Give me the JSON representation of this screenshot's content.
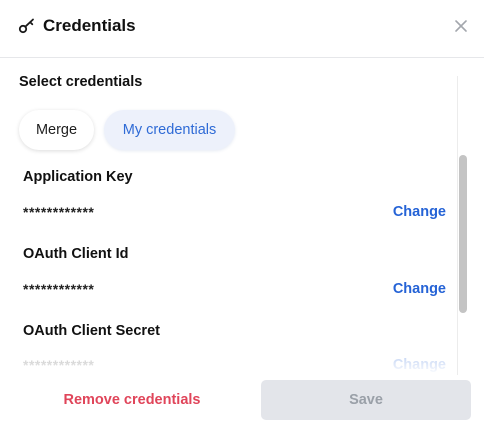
{
  "header": {
    "title": "Credentials",
    "icon": "key-icon",
    "close_icon": "close-icon"
  },
  "section_title": "Select credentials",
  "tabs": [
    {
      "label": "Merge",
      "selected": false
    },
    {
      "label": "My credentials",
      "selected": true
    }
  ],
  "credentials": [
    {
      "name": "Application Key",
      "value": "************",
      "action": "Change"
    },
    {
      "name": "OAuth Client Id",
      "value": "************",
      "action": "Change"
    },
    {
      "name": "OAuth Client Secret",
      "value": "************",
      "action": "Change"
    }
  ],
  "footer": {
    "remove_label": "Remove credentials",
    "save_label": "Save",
    "save_disabled": true
  },
  "colors": {
    "accent": "#2563d6",
    "danger": "#e0455a",
    "selected_pill_bg": "#edf1fb",
    "disabled_bg": "#e3e5ea"
  }
}
